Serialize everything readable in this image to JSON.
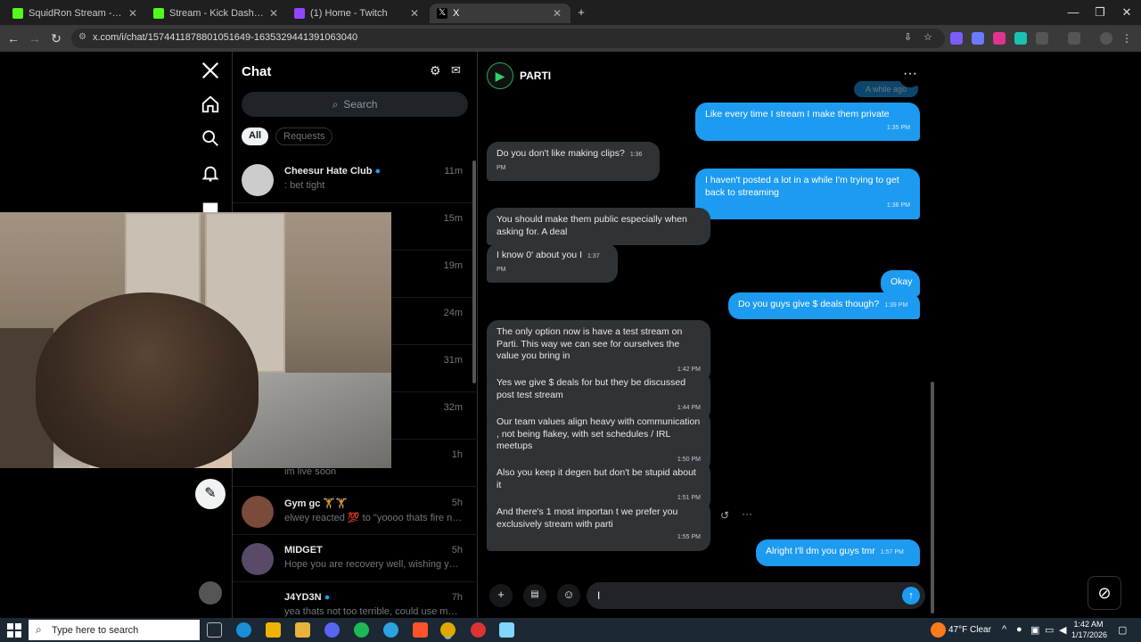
{
  "browser": {
    "tabs": [
      {
        "title": "SquidRon Stream - Watch Live",
        "color": "#53fc18"
      },
      {
        "title": "Stream - Kick Dashboard",
        "color": "#53fc18"
      },
      {
        "title": "(1) Home - Twitch",
        "color": "#9146ff"
      },
      {
        "title": "X",
        "color": "#ffffff"
      }
    ],
    "new_tab": "+",
    "url": "x.com/i/chat/1574411878801051649-1635329441391063040"
  },
  "chatlist": {
    "title": "Chat",
    "search_placeholder": "Search",
    "filter_all": "All",
    "filter_requests": "Requests",
    "conversations": [
      {
        "name": "Cheesur Hate Club",
        "preview": ": bet tight",
        "time": "11m"
      },
      {
        "name": "Gym gc 🏋️🏋️",
        "preview": "elwey reacted 💯 to \"yoooo thats fire ngl ...",
        "time": "5h"
      },
      {
        "name": "MIDGET",
        "preview": "Hope you are recovery well, wishing you a ...",
        "time": "5h"
      },
      {
        "name": "J4YD3N",
        "preview": "yea thats not too terrible, could use more ...",
        "time": "7h"
      }
    ],
    "hidden_times": [
      "15m",
      "19m",
      "24m",
      "31m",
      "32m",
      "1h"
    ],
    "partial_preview": "im live soon"
  },
  "conversation": {
    "name": "PARTI",
    "faded_text": "A while ago",
    "messages": [
      {
        "dir": "out",
        "text": "Like every time I stream I make them private",
        "time": "1:35 PM"
      },
      {
        "dir": "in",
        "text": "Do you don't like making clips?",
        "time": "1:36 PM"
      },
      {
        "dir": "out",
        "text": "I haven't posted a lot in a while I'm trying to get back to streaming",
        "time": "1:36 PM"
      },
      {
        "dir": "in",
        "text": "You should make them public especially when asking  for. A deal",
        "time": ""
      },
      {
        "dir": "in",
        "text": "I know 0' about you I",
        "time": "1:37 PM"
      },
      {
        "dir": "out",
        "text": "Okay",
        "time": ""
      },
      {
        "dir": "out",
        "text": "Do you guys give $ deals though?",
        "time": "1:39 PM"
      },
      {
        "dir": "in",
        "text": "The only option now is have a test stream on Parti. This way we can see for ourselves the value you bring in",
        "time": "1:42 PM"
      },
      {
        "dir": "in",
        "text": "Yes we give $ deals for but they be discussed post test stream",
        "time": "1:44 PM"
      },
      {
        "dir": "in",
        "text": "Our team values align heavy with communication , not being flakey, with set schedules / IRL meetups",
        "time": "1:50 PM"
      },
      {
        "dir": "in",
        "text": "Also you keep it degen but don't  be stupid about it",
        "time": "1:51 PM"
      },
      {
        "dir": "in",
        "text": "And there's 1 most importan t we prefer you exclusively stream with parti",
        "time": "1:55 PM"
      },
      {
        "dir": "out",
        "text": "Alright I'll dm you guys tmr",
        "time": "1:57 PM"
      }
    ],
    "input_value": "I"
  },
  "taskbar": {
    "search_placeholder": "Type here to search",
    "weather": "47°F  Clear",
    "time": "1:42 AM",
    "date": "1/17/2026"
  }
}
